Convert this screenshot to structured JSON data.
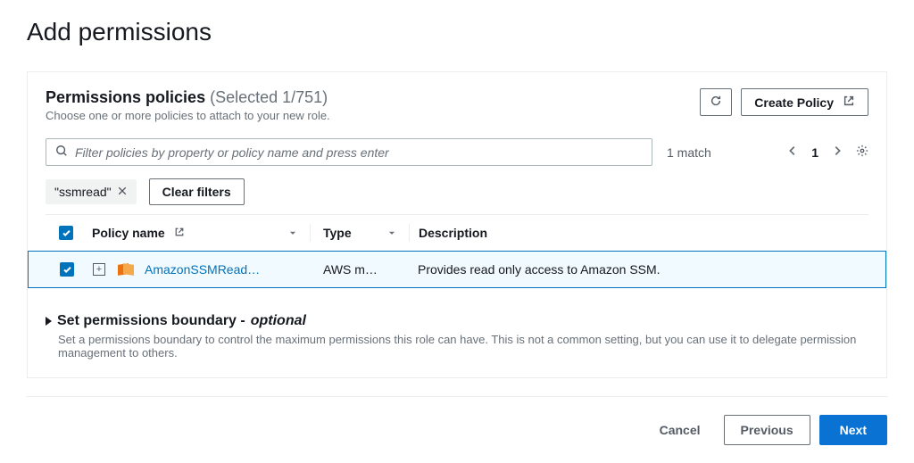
{
  "page_title": "Add permissions",
  "section": {
    "title_strong": "Permissions policies",
    "title_count": "(Selected 1/751)",
    "subtitle": "Choose one or more policies to attach to your new role."
  },
  "actions": {
    "refresh_tooltip": "Refresh",
    "create_policy_label": "Create Policy"
  },
  "search": {
    "placeholder": "Filter policies by property or policy name and press enter",
    "matches_text": "1 match",
    "page_current": "1"
  },
  "filters": {
    "chip_text": "\"ssmread\"",
    "clear_label": "Clear filters"
  },
  "columns": {
    "name": "Policy name",
    "type": "Type",
    "desc": "Description"
  },
  "rows": [
    {
      "name": "AmazonSSMRead…",
      "type": "AWS m…",
      "desc": "Provides read only access to Amazon SSM."
    }
  ],
  "boundary": {
    "title_strong": "Set permissions boundary -",
    "title_optional": "optional",
    "subtitle": "Set a permissions boundary to control the maximum permissions this role can have. This is not a common setting, but you can use it to delegate permission management to others."
  },
  "footer": {
    "cancel": "Cancel",
    "previous": "Previous",
    "next": "Next"
  }
}
